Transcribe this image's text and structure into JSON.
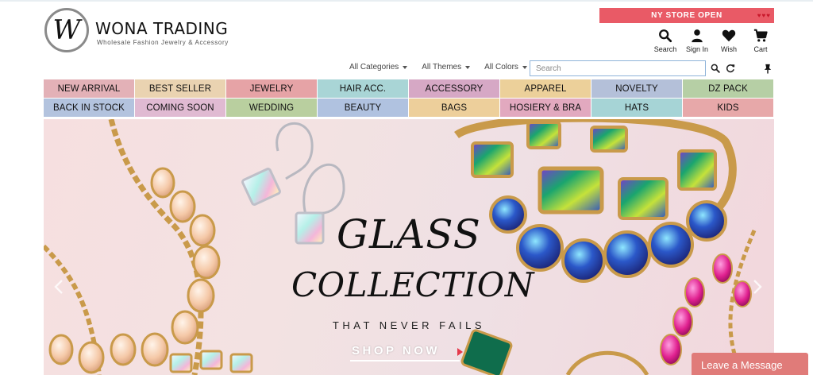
{
  "brand": {
    "logo_letter": "W",
    "name": "WONA TRADING",
    "tagline": "Wholesale Fashion Jewelry & Accessory"
  },
  "store_banner": {
    "text": "NY STORE OPEN",
    "accent": "#e95a66"
  },
  "header_icons": [
    {
      "icon": "search-icon",
      "label": "Search"
    },
    {
      "icon": "user-icon",
      "label": "Sign In"
    },
    {
      "icon": "heart-icon",
      "label": "Wish"
    },
    {
      "icon": "cart-icon",
      "label": "Cart"
    }
  ],
  "filters": {
    "categories": "All Categories",
    "themes": "All Themes",
    "colors": "All Colors"
  },
  "search": {
    "placeholder": "Search",
    "value": ""
  },
  "categories": [
    {
      "label": "NEW ARRIVAL",
      "color": "#e3b1b7"
    },
    {
      "label": "BEST SELLER",
      "color": "#ead3b1"
    },
    {
      "label": "JEWELRY",
      "color": "#e6a3a6"
    },
    {
      "label": "HAIR ACC.",
      "color": "#a9d5d6"
    },
    {
      "label": "ACCESSORY",
      "color": "#d6a8c5"
    },
    {
      "label": "APPAREL",
      "color": "#ecd09a"
    },
    {
      "label": "NOVELTY",
      "color": "#b4c0d9"
    },
    {
      "label": "DZ PACK",
      "color": "#b6cfa5"
    },
    {
      "label": "BACK IN STOCK",
      "color": "#b3c3de"
    },
    {
      "label": "COMING SOON",
      "color": "#e0bad2"
    },
    {
      "label": "WEDDING",
      "color": "#b9cf9f"
    },
    {
      "label": "BEAUTY",
      "color": "#b0c2e0"
    },
    {
      "label": "BAGS",
      "color": "#edcf9b"
    },
    {
      "label": "HOSIERY & BRA",
      "color": "#e2a9bf"
    },
    {
      "label": "HATS",
      "color": "#a6d4d6"
    },
    {
      "label": "KIDS",
      "color": "#e7a8a9"
    }
  ],
  "hero": {
    "title_line1": "GLASS",
    "title_line2": "COLLECTION",
    "tagline": "THAT NEVER FAILS",
    "cta": "SHOP NOW"
  },
  "chat": {
    "label": "Leave a Message"
  }
}
